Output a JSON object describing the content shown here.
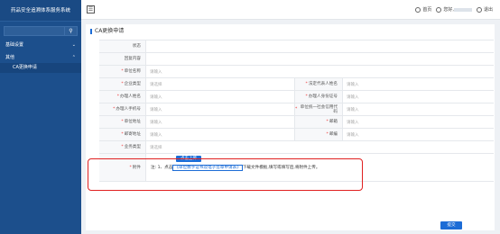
{
  "app": {
    "title": "药品安全追溯体系服务系统"
  },
  "sidebar": {
    "search_placeholder": "",
    "groups": [
      {
        "label": "基础设置"
      },
      {
        "label": "其他"
      }
    ],
    "items": [
      {
        "label": "CA更换申请"
      }
    ]
  },
  "topbar": {
    "home": "首页",
    "greeting": "您好,",
    "logout": "退出"
  },
  "panel": {
    "title": "CA更换申请"
  },
  "form": {
    "status_label": "状态",
    "reply_label": "回复内容",
    "unit_name_label": "单位名称",
    "unit_name_placeholder": "请输入",
    "company_type_label": "企业类型",
    "company_type_placeholder": "请选择",
    "legal_rep_label": "法定代表人姓名",
    "legal_rep_placeholder": "请输入",
    "handler_name_label": "办理人姓名",
    "handler_name_placeholder": "请输入",
    "handler_id_label": "办理人身份证号",
    "handler_id_placeholder": "请输入",
    "handler_phone_label": "办理人手机号",
    "handler_phone_placeholder": "请输入",
    "credit_code_label": "单位统一社会信用代码",
    "credit_code_placeholder": "请输入",
    "unit_address_label": "单位地址",
    "unit_address_placeholder": "请输入",
    "email_label": "邮箱",
    "email_placeholder": "请输入",
    "mail_address_label": "邮寄地址",
    "mail_address_placeholder": "请输入",
    "postcode_label": "邮编",
    "postcode_placeholder": "请输入",
    "business_type_label": "业务类型",
    "business_type_placeholder": "请选择",
    "attachment_label": "附件",
    "upload_label": "点击上传",
    "note_prefix": "注: 1、点击",
    "note_link": "《单位数字证书及电子签章申请表》",
    "note_suffix": "下载文件模板,填写或填写后,将附件上传。"
  },
  "actions": {
    "submit": "提交"
  },
  "colors": {
    "sidebar": "#1c4f8c",
    "accent": "#1c6cd6",
    "highlight": "#e02020"
  }
}
